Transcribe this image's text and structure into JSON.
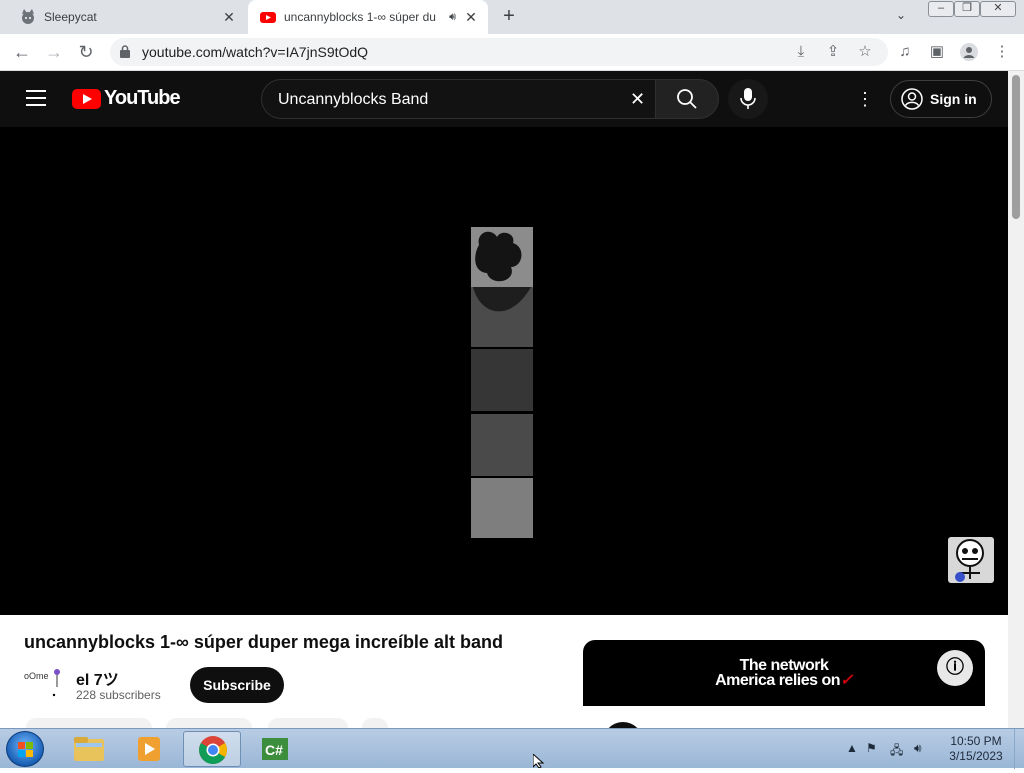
{
  "browser": {
    "tabs": [
      {
        "label": "Sleepycat",
        "icon": "cat-favicon-icon",
        "active": false
      },
      {
        "label": "uncannyblocks 1-∞ súper du",
        "icon": "youtube-favicon-icon",
        "active": true,
        "audio": true
      }
    ],
    "url": "youtube.com/watch?v=IA7jnS9tOdQ"
  },
  "youtube": {
    "logo_text": "YouTube",
    "search_value": "Uncannyblocks Band",
    "sign_in_label": "Sign in"
  },
  "video": {
    "title": "uncannyblocks 1-∞ súper duper mega increíble alt band",
    "channel_name": "el 7ツ",
    "subscribers": "228 subscribers",
    "subscribe_label": "Subscribe",
    "channel_avatar_text": "oOme"
  },
  "ad": {
    "line1": "The network",
    "line2": "America relies on",
    "accent_color": "#cd040b"
  },
  "taskbar": {
    "time": "10:50 PM",
    "date": "3/15/2023",
    "apps": [
      "windows-explorer",
      "media-player",
      "chrome",
      "csharp-app"
    ]
  },
  "colors": {
    "youtube_red": "#ff0000",
    "youtube_dark": "#0f0f0f",
    "tab_strip": "#dee1e6"
  }
}
